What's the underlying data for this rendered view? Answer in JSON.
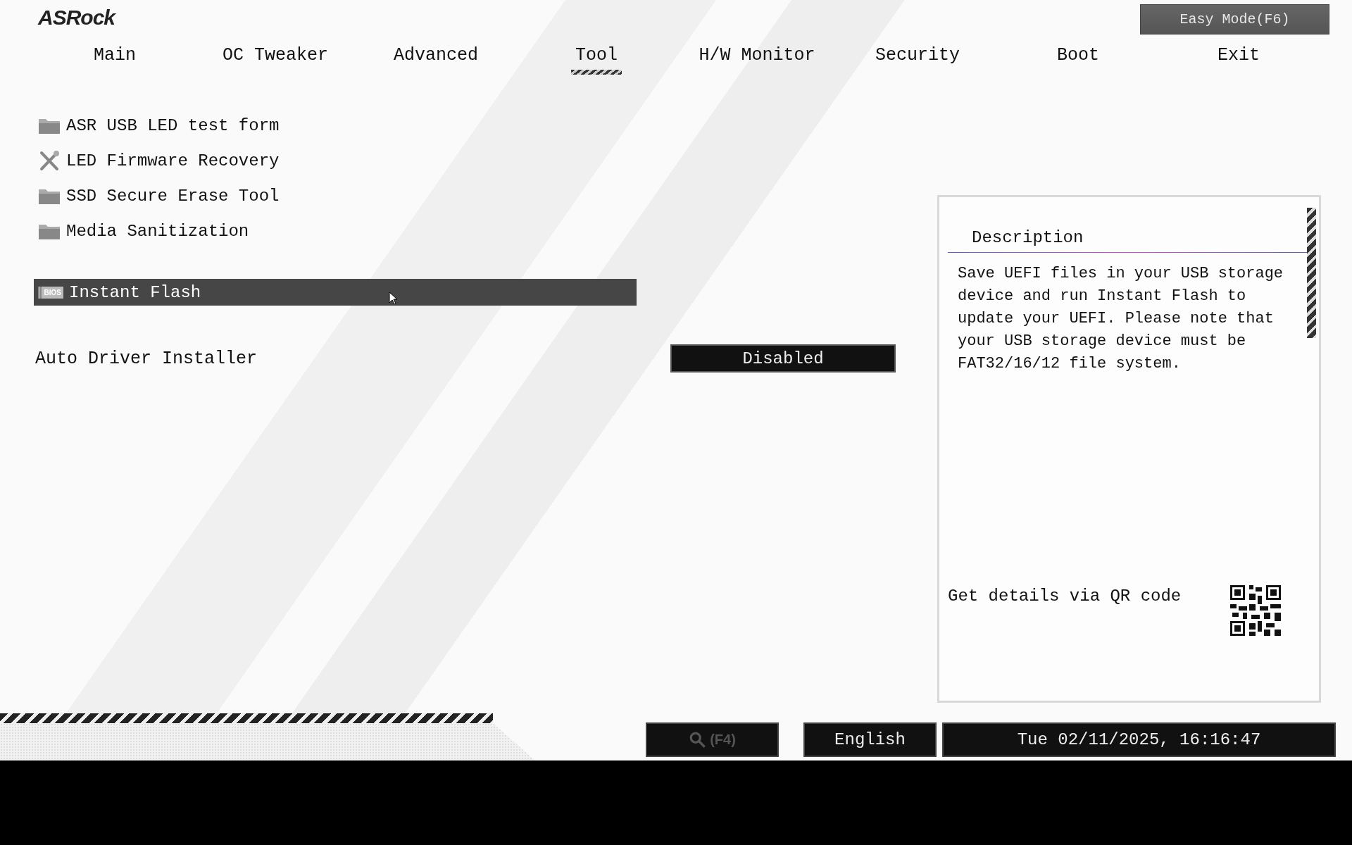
{
  "header": {
    "logo": "ASRock",
    "easy_mode_button": "Easy Mode(F6)"
  },
  "tabs": [
    {
      "label": "Main",
      "selected": false
    },
    {
      "label": "OC Tweaker",
      "selected": false
    },
    {
      "label": "Advanced",
      "selected": false
    },
    {
      "label": "Tool",
      "selected": true
    },
    {
      "label": "H/W Monitor",
      "selected": false
    },
    {
      "label": "Security",
      "selected": false
    },
    {
      "label": "Boot",
      "selected": false
    },
    {
      "label": "Exit",
      "selected": false
    }
  ],
  "menu_items": [
    {
      "label": "ASR USB LED test form",
      "kind": "folder",
      "selected": false
    },
    {
      "label": "LED Firmware Recovery",
      "kind": "tools",
      "selected": false
    },
    {
      "label": "SSD Secure Erase Tool",
      "kind": "folder",
      "selected": false
    },
    {
      "label": "Media Sanitization",
      "kind": "folder",
      "selected": false
    },
    {
      "label": "Instant Flash",
      "kind": "bios",
      "badge": "BIOS",
      "selected": true
    }
  ],
  "settings": [
    {
      "label": "Auto Driver Installer",
      "value": "Disabled"
    }
  ],
  "description": {
    "title": "Description",
    "text": "Save UEFI files in your USB storage device and run Instant Flash to update your UEFI. Please note that your USB storage device must be FAT32/16/12 file system.",
    "qr_label": "Get details via QR code"
  },
  "status_bar": {
    "search": "(F4)",
    "language": "English",
    "datetime": "Tue 02/11/2025, 16:16:47"
  }
}
